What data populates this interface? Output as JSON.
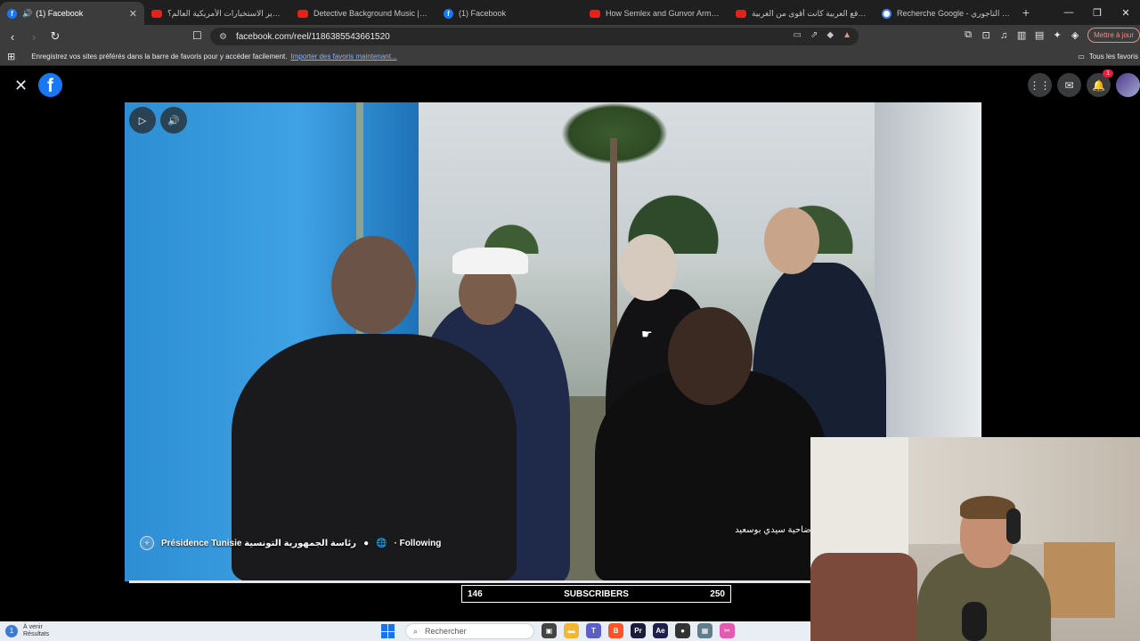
{
  "browser": {
    "tabs": [
      {
        "label": "(1) Facebook",
        "icon": "facebook-icon",
        "active": true
      },
      {
        "label": "كيف تدير الاستخبارات الأمريكية العالم؟",
        "icon": "youtube-icon"
      },
      {
        "label": "Detective Background Music | Crime",
        "icon": "youtube-icon"
      },
      {
        "label": "(1) Facebook",
        "icon": "facebook-icon"
      },
      {
        "label": "How Semlex and Gunvor Armed the",
        "icon": "youtube-icon"
      },
      {
        "label": "المواقع العربية كانت أقوى من الغربية",
        "icon": "youtube-icon"
      },
      {
        "label": "Recherche Google - هيثم التاجوري",
        "icon": "google-icon"
      }
    ],
    "url": "facebook.com/reel/1186385543661520",
    "update_label": "Mettre à jour",
    "bookmarks_prompt": "Enregistrez vos sites préférés dans la barre de favoris pour y accéder facilement.",
    "bookmarks_import": "Importer des favoris maintenant...",
    "all_favorites": "Tous les favoris"
  },
  "facebook": {
    "notification_count": "1",
    "page_name": "Présidence Tunisie رئاسة الجمهورية التونسية",
    "following": "· Following",
    "caption": "منطقة البحر الأزرق من معتمدية المرسى وضاحية سيدي بوسعيد"
  },
  "overlay": {
    "left_count": "146",
    "label": "SUBSCRIBERS",
    "right_count": "250"
  },
  "taskbar": {
    "weather_title": "À venir",
    "weather_sub": "Résultats",
    "weather_badge": "1",
    "search_placeholder": "Rechercher"
  }
}
